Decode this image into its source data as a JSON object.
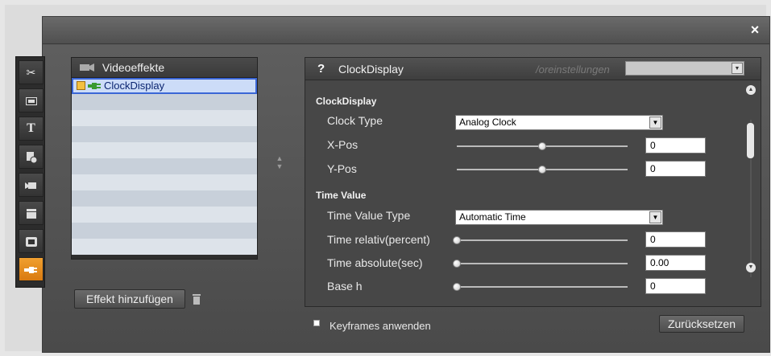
{
  "dialog": {
    "close_glyph": "×"
  },
  "toolbar": {
    "items": [
      {
        "icon": "scissors-icon",
        "glyph": "✂"
      },
      {
        "icon": "picture-icon",
        "glyph": ""
      },
      {
        "icon": "text-icon",
        "glyph": "T"
      },
      {
        "icon": "document-plus-icon",
        "glyph": ""
      },
      {
        "icon": "camera-icon",
        "glyph": ""
      },
      {
        "icon": "clapperboard-icon",
        "glyph": ""
      },
      {
        "icon": "frame-icon",
        "glyph": ""
      },
      {
        "icon": "plugin-icon",
        "glyph": "",
        "active": true
      }
    ]
  },
  "effects": {
    "header": "Videoeffekte",
    "items": [
      "ClockDisplay"
    ],
    "add_button": "Effekt hinzufügen"
  },
  "settings": {
    "help_glyph": "?",
    "title": "ClockDisplay",
    "presets_label": "/oreinstellungen",
    "groups": [
      {
        "title": "ClockDisplay",
        "params": [
          {
            "label": "Clock Type",
            "type": "dropdown",
            "value": "Analog Clock"
          },
          {
            "label": "X-Pos",
            "type": "slider",
            "value": "0",
            "fraction": 0.5
          },
          {
            "label": "Y-Pos",
            "type": "slider",
            "value": "0",
            "fraction": 0.5
          }
        ]
      },
      {
        "title": "Time Value",
        "params": [
          {
            "label": "Time Value Type",
            "type": "dropdown",
            "value": "Automatic Time"
          },
          {
            "label": "Time relativ(percent)",
            "type": "slider",
            "value": "0",
            "fraction": 0.0
          },
          {
            "label": "Time absolute(sec)",
            "type": "slider",
            "value": "0.00",
            "fraction": 0.0
          },
          {
            "label": "Base h",
            "type": "slider",
            "value": "0",
            "fraction": 0.0
          }
        ]
      }
    ],
    "keyframes_label": "Keyframes anwenden",
    "reset_button": "Zurücksetzen"
  },
  "colors": {
    "accent": "#e88a1a",
    "selection": "#3a66d6"
  }
}
